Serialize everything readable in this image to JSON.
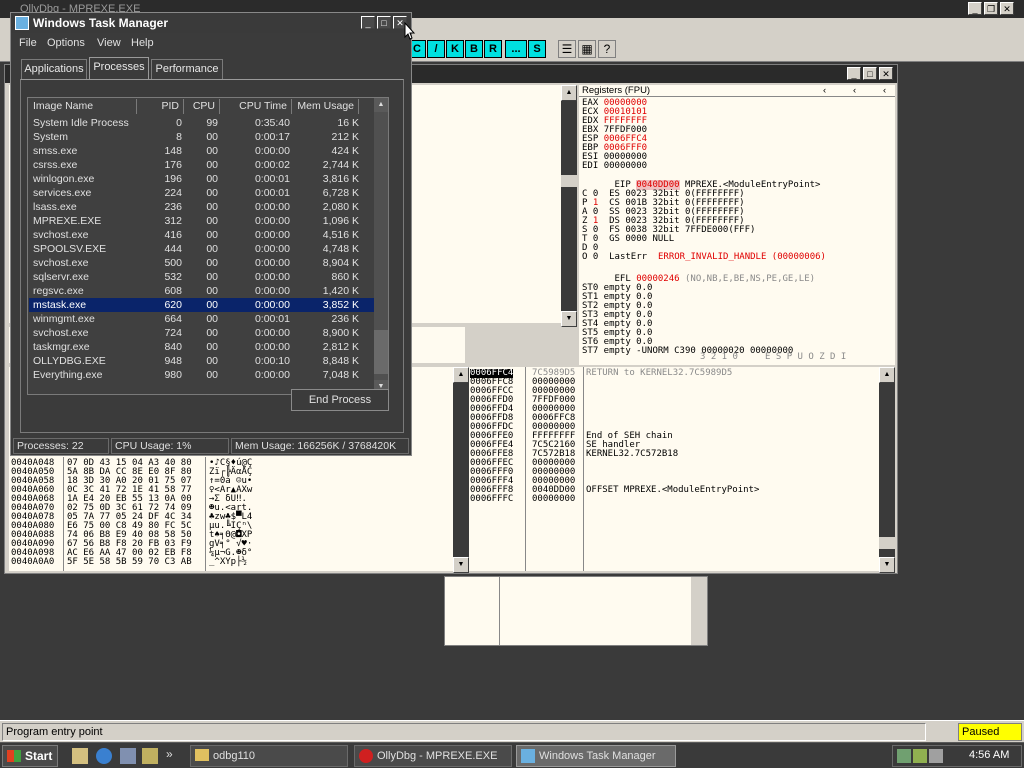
{
  "olly": {
    "title": "OllyDbg - MPREXE.EXE",
    "toolbar_letters": [
      "C",
      "/",
      "K",
      "B",
      "R",
      "...",
      "S"
    ],
    "status_text": "Program entry point",
    "paused_label": "Paused"
  },
  "cpu": {
    "registers_header": "Registers (FPU)",
    "gp": [
      {
        "name": "EAX",
        "value": "00000000",
        "red": true
      },
      {
        "name": "ECX",
        "value": "00010101",
        "red": true
      },
      {
        "name": "EDX",
        "value": "FFFFFFFF",
        "red": true
      },
      {
        "name": "EBX",
        "value": "7FFDF000",
        "red": false
      },
      {
        "name": "ESP",
        "value": "0006FFC4",
        "red": true
      },
      {
        "name": "EBP",
        "value": "0006FFF0",
        "red": true
      },
      {
        "name": "ESI",
        "value": "00000000",
        "red": false
      },
      {
        "name": "EDI",
        "value": "00000000",
        "red": false
      }
    ],
    "eip_line": {
      "name": "EIP",
      "value": "0040DD00",
      "desc": "MPREXE.<ModuleEntryPoint>"
    },
    "flags": [
      {
        "flag": "C",
        "val": "0",
        "seg": "ES 0023 32bit 0(FFFFFFFF)"
      },
      {
        "flag": "P",
        "val": "1",
        "seg": "CS 001B 32bit 0(FFFFFFFF)"
      },
      {
        "flag": "A",
        "val": "0",
        "seg": "SS 0023 32bit 0(FFFFFFFF)"
      },
      {
        "flag": "Z",
        "val": "1",
        "seg": "DS 0023 32bit 0(FFFFFFFF)"
      },
      {
        "flag": "S",
        "val": "0",
        "seg": "FS 0038 32bit 7FFDE000(FFF)"
      },
      {
        "flag": "T",
        "val": "0",
        "seg": "GS 0000 NULL"
      },
      {
        "flag": "D",
        "val": "0",
        "seg": ""
      },
      {
        "flag": "O",
        "val": "0",
        "seg": "LastErr "
      }
    ],
    "lasterr_value": "ERROR_INVALID_HANDLE (00000006)",
    "efl_label": "EFL",
    "efl_value": "00000246",
    "efl_desc": "(NO,NB,E,BE,NS,PE,GE,LE)",
    "fpu": [
      "ST0 empty 0.0",
      "ST1 empty 0.0",
      "ST2 empty 0.0",
      "ST3 empty 0.0",
      "ST4 empty 0.0",
      "ST5 empty 0.0",
      "ST6 empty 0.0",
      "ST7 empty -UNORM C390 00000020 00000000"
    ],
    "fpu_bits": "3 2 1 0     E S P U O Z D I",
    "stack": [
      {
        "addr": "0006FFC4",
        "val": "7C5989D5",
        "comment": "RETURN to KERNEL32.7C5989D5",
        "sel": true
      },
      {
        "addr": "0006FFC8",
        "val": "00000000",
        "comment": ""
      },
      {
        "addr": "0006FFCC",
        "val": "00000000",
        "comment": ""
      },
      {
        "addr": "0006FFD0",
        "val": "7FFDF000",
        "comment": ""
      },
      {
        "addr": "0006FFD4",
        "val": "00000000",
        "comment": ""
      },
      {
        "addr": "0006FFD8",
        "val": "0006FFC8",
        "comment": ""
      },
      {
        "addr": "0006FFDC",
        "val": "00000000",
        "comment": ""
      },
      {
        "addr": "0006FFE0",
        "val": "FFFFFFFF",
        "comment": "End of SEH chain"
      },
      {
        "addr": "0006FFE4",
        "val": "7C5C2160",
        "comment": "SE handler"
      },
      {
        "addr": "0006FFE8",
        "val": "7C572B18",
        "comment": "KERNEL32.7C572B18"
      },
      {
        "addr": "0006FFEC",
        "val": "00000000",
        "comment": ""
      },
      {
        "addr": "0006FFF0",
        "val": "00000000",
        "comment": ""
      },
      {
        "addr": "0006FFF4",
        "val": "00000000",
        "comment": ""
      },
      {
        "addr": "0006FFF8",
        "val": "0040DD00",
        "comment": "OFFSET MPREXE.<ModuleEntryPoint>"
      },
      {
        "addr": "0006FFFC",
        "val": "00000000",
        "comment": ""
      }
    ],
    "dump": [
      {
        "addr": "0040A048",
        "hex": "07 0D 43 15 04 A3 40 80",
        "ascii": "•♪C§♦ú@Ç"
      },
      {
        "addr": "0040A050",
        "hex": "5A 8B DA CC 8E E0 8F 80",
        "ascii": "Zï┌╠ÄαÅÇ"
      },
      {
        "addr": "0040A058",
        "hex": "18 3D 30 A0 20 01 75 07",
        "ascii": "↑=0á ☺u•"
      },
      {
        "addr": "0040A060",
        "hex": "0C 3C 41 72 1E 41 58 77",
        "ascii": "♀<Ar▲AXw"
      },
      {
        "addr": "0040A068",
        "hex": "1A E4 20 EB 55 13 0A 00",
        "ascii": "→Σ δU‼."
      },
      {
        "addr": "0040A070",
        "hex": "02 75 0D 3C 61 72 74 09",
        "ascii": "☻u.<art."
      },
      {
        "addr": "0040A078",
        "hex": "05 7A 77 05 24 DF 4C 34",
        "ascii": "♣zw♣$▀L4"
      },
      {
        "addr": "0040A080",
        "hex": "E6 75 00 C8 49 80 FC 5C",
        "ascii": "µu.╚IÇⁿ\\"
      },
      {
        "addr": "0040A088",
        "hex": "74 06 B8 E9 40 08 58 50",
        "ascii": "t♠╕Θ@◘XP"
      },
      {
        "addr": "0040A090",
        "hex": "67 56 B8 F8 20 FB 03 F9",
        "ascii": "gV╕° √♥·"
      },
      {
        "addr": "0040A098",
        "hex": "AC E6 AA 47 00 02 EB F8",
        "ascii": "¼µ¬G.☻δ°"
      },
      {
        "addr": "0040A0A0",
        "hex": "5F 5E 58 5B 59 70 C3 AB",
        "ascii": "_^XYp├½"
      }
    ]
  },
  "taskmgr": {
    "title": "Windows Task Manager",
    "menu": [
      "File",
      "Options",
      "View",
      "Help"
    ],
    "tabs": [
      "Applications",
      "Processes",
      "Performance"
    ],
    "columns": [
      "Image Name",
      "PID",
      "CPU",
      "CPU Time",
      "Mem Usage"
    ],
    "rows": [
      {
        "name": "System Idle Process",
        "pid": "0",
        "cpu": "99",
        "time": "0:35:40",
        "mem": "16 K"
      },
      {
        "name": "System",
        "pid": "8",
        "cpu": "00",
        "time": "0:00:17",
        "mem": "212 K"
      },
      {
        "name": "smss.exe",
        "pid": "148",
        "cpu": "00",
        "time": "0:00:00",
        "mem": "424 K"
      },
      {
        "name": "csrss.exe",
        "pid": "176",
        "cpu": "00",
        "time": "0:00:02",
        "mem": "2,744 K"
      },
      {
        "name": "winlogon.exe",
        "pid": "196",
        "cpu": "00",
        "time": "0:00:01",
        "mem": "3,816 K"
      },
      {
        "name": "services.exe",
        "pid": "224",
        "cpu": "00",
        "time": "0:00:01",
        "mem": "6,728 K"
      },
      {
        "name": "lsass.exe",
        "pid": "236",
        "cpu": "00",
        "time": "0:00:00",
        "mem": "2,080 K"
      },
      {
        "name": "MPREXE.EXE",
        "pid": "312",
        "cpu": "00",
        "time": "0:00:00",
        "mem": "1,096 K"
      },
      {
        "name": "svchost.exe",
        "pid": "416",
        "cpu": "00",
        "time": "0:00:00",
        "mem": "4,516 K"
      },
      {
        "name": "SPOOLSV.EXE",
        "pid": "444",
        "cpu": "00",
        "time": "0:00:00",
        "mem": "4,748 K"
      },
      {
        "name": "svchost.exe",
        "pid": "500",
        "cpu": "00",
        "time": "0:00:00",
        "mem": "8,904 K"
      },
      {
        "name": "sqlservr.exe",
        "pid": "532",
        "cpu": "00",
        "time": "0:00:00",
        "mem": "860 K"
      },
      {
        "name": "regsvc.exe",
        "pid": "608",
        "cpu": "00",
        "time": "0:00:00",
        "mem": "1,420 K"
      },
      {
        "name": "mstask.exe",
        "pid": "620",
        "cpu": "00",
        "time": "0:00:00",
        "mem": "3,852 K",
        "selected": true
      },
      {
        "name": "winmgmt.exe",
        "pid": "664",
        "cpu": "00",
        "time": "0:00:01",
        "mem": "236 K"
      },
      {
        "name": "svchost.exe",
        "pid": "724",
        "cpu": "00",
        "time": "0:00:00",
        "mem": "8,900 K"
      },
      {
        "name": "taskmgr.exe",
        "pid": "840",
        "cpu": "00",
        "time": "0:00:00",
        "mem": "2,812 K"
      },
      {
        "name": "OLLYDBG.EXE",
        "pid": "948",
        "cpu": "00",
        "time": "0:00:10",
        "mem": "8,848 K"
      },
      {
        "name": "Everything.exe",
        "pid": "980",
        "cpu": "00",
        "time": "0:00:00",
        "mem": "7,048 K"
      }
    ],
    "end_process_label": "End Process",
    "status": {
      "processes": "Processes: 22",
      "cpu": "CPU Usage: 1%",
      "mem": "Mem Usage: 166256K / 3768420K"
    }
  },
  "taskbar": {
    "start_label": "Start",
    "tasks": [
      {
        "label": "odbg110",
        "icon": "folder-icon"
      },
      {
        "label": "OllyDbg - MPREXE.EXE",
        "icon": "bug-icon"
      },
      {
        "label": "Windows Task Manager",
        "icon": "taskmgr-icon",
        "active": true
      }
    ],
    "clock": "4:56 AM"
  }
}
